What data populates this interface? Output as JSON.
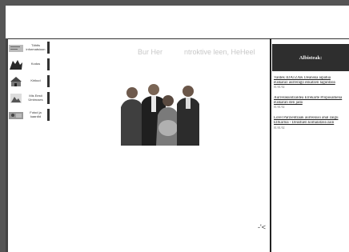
{
  "nav": {
    "items": [
      {
        "label": "Tähtis informatsioon"
      },
      {
        "label": "Kodus"
      },
      {
        "label": "Kirikud"
      },
      {
        "label": "Mis Eesti Ümbruses"
      },
      {
        "label": "Fotod ja kaardid"
      }
    ]
  },
  "banner": {
    "part1": "Bur Her",
    "part2": "ntroktive leen, HeHeel"
  },
  "panel": {
    "title": "Albisteak:"
  },
  "news": [
    {
      "text": "Valdek IDATZAK Deanska aipatua",
      "line2": "euskaraz aurrerago eskatzen laguntzea",
      "date": "01/01/02"
    },
    {
      "text": "Aurrerakuntzaldea Errekarte Proposamena",
      "line2": "euskaran den jada",
      "date": "01/01/02"
    },
    {
      "text": "Lorel Parzientzaak aurreikusi ahal zaigu",
      "line2": "Elrkarloa - Deustuen komalatzea zain",
      "date": "01/01/02"
    }
  ],
  "misc": {
    "cursor_glyph": "-'<"
  }
}
